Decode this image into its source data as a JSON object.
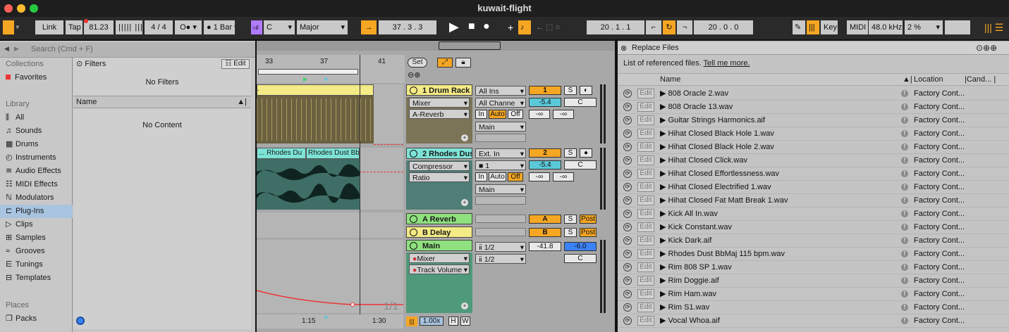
{
  "title": "kuwait-flight",
  "controlbar": {
    "link": "Link",
    "tap": "Tap",
    "tempo": "81.23",
    "signature": "4 / 4",
    "metro": "O● ▾",
    "quantize": "1 Bar",
    "key": "C",
    "scale": "Major",
    "position": "37 .  3 .  3",
    "loop_start": "20 .  1 .  1",
    "loop_length": "20 .  0 .  0",
    "key_label": "Key",
    "midi_label": "MIDI",
    "sample_rate": "48.0 kHz",
    "cpu": "2 %"
  },
  "browser": {
    "search_placeholder": "Search (Cmd + F)",
    "collections_label": "Collections",
    "favorites": "Favorites",
    "library_label": "Library",
    "items": [
      "All",
      "Sounds",
      "Drums",
      "Instruments",
      "Audio Effects",
      "MIDI Effects",
      "Modulators",
      "Plug-Ins",
      "Clips",
      "Samples",
      "Grooves",
      "Tunings",
      "Templates"
    ],
    "places_label": "Places",
    "packs": "Packs",
    "filters_label": "Filters",
    "edit_label": "Edit",
    "no_filters": "No Filters",
    "name_col": "Name",
    "no_content": "No Content"
  },
  "arrangement": {
    "ruler": [
      "33",
      "37",
      "41"
    ],
    "timeline": [
      "1:15",
      "1:30"
    ],
    "set_label": "Set",
    "tracks": [
      {
        "name": "1 Drum Rack",
        "color": "#f4ea86",
        "devices": [
          "Mixer",
          "A-Reverb"
        ],
        "input": "All Ins",
        "channel": "All Channe",
        "monitor": [
          "In",
          "Auto",
          "Off"
        ],
        "output": "Main",
        "number": "1",
        "vol": "-5.4",
        "pan": "C",
        "sends": [
          "-∞",
          "-∞"
        ]
      },
      {
        "name": "2 Rhodes Dus",
        "color": "#7de3d6",
        "devices": [
          "Compressor",
          "Ratio"
        ],
        "input": "Ext. In",
        "channel": "1",
        "monitor": [
          "In",
          "Auto",
          "Off"
        ],
        "output": "Main",
        "number": "2",
        "vol": "-5.4",
        "pan": "C",
        "sends": [
          "-∞",
          "-∞"
        ]
      }
    ],
    "clip_labels": [
      "... Rhodes Du",
      "Rhodes Dust Bb"
    ],
    "returns": [
      {
        "name": "A Reverb",
        "color": "#8fe07e",
        "letter": "A",
        "post": "Post"
      },
      {
        "name": "B Delay",
        "color": "#f4ea86",
        "letter": "B",
        "post": "Post"
      }
    ],
    "main": {
      "name": "Main",
      "devices": [
        "Mixer",
        "Track Volume"
      ],
      "outs": [
        "1/2",
        "1/2"
      ],
      "vol": "-41.8",
      "peak": "-6.0",
      "pan": "C"
    },
    "solo": "S",
    "page_counter": "1/1",
    "zoom": "1.00x",
    "h_label": "H",
    "w_label": "W"
  },
  "replace": {
    "title": "Replace Files",
    "desc": "List of referenced files.",
    "link": "Tell me more.",
    "cols": {
      "name": "Name",
      "location": "Location",
      "cand": "Cand..."
    },
    "edit": "Edit",
    "files": [
      {
        "name": "808 Oracle 2.wav",
        "loc": "Factory Cont..."
      },
      {
        "name": "808 Oracle 13.wav",
        "loc": "Factory Cont..."
      },
      {
        "name": "Guitar Strings Harmonics.aif",
        "loc": "Factory Cont..."
      },
      {
        "name": "Hihat Closed Black Hole 1.wav",
        "loc": "Factory Cont..."
      },
      {
        "name": "Hihat Closed Black Hole 2.wav",
        "loc": "Factory Cont..."
      },
      {
        "name": "Hihat Closed Click.wav",
        "loc": "Factory Cont..."
      },
      {
        "name": "Hihat Closed Effortlessness.wav",
        "loc": "Factory Cont..."
      },
      {
        "name": "Hihat Closed Electrified 1.wav",
        "loc": "Factory Cont..."
      },
      {
        "name": "Hihat Closed Fat Matt Break 1.wav",
        "loc": "Factory Cont..."
      },
      {
        "name": "Kick All In.wav",
        "loc": "Factory Cont..."
      },
      {
        "name": "Kick Constant.wav",
        "loc": "Factory Cont..."
      },
      {
        "name": "Kick Dark.aif",
        "loc": "Factory Cont..."
      },
      {
        "name": "Rhodes Dust BbMaj 115 bpm.wav",
        "loc": "Factory Cont..."
      },
      {
        "name": "Rim 808 SP 1.wav",
        "loc": "Factory Cont..."
      },
      {
        "name": "Rim Doggie.aif",
        "loc": "Factory Cont..."
      },
      {
        "name": "Rim Ham.wav",
        "loc": "Factory Cont..."
      },
      {
        "name": "Rim S1.wav",
        "loc": "Factory Cont..."
      },
      {
        "name": "Vocal Whoa.aif",
        "loc": "Factory Cont..."
      }
    ]
  },
  "colors": {
    "orange": "#f5a623",
    "cyan": "#5bc8d8",
    "blue": "#3b82f6",
    "selection": "#a8c4e0"
  }
}
